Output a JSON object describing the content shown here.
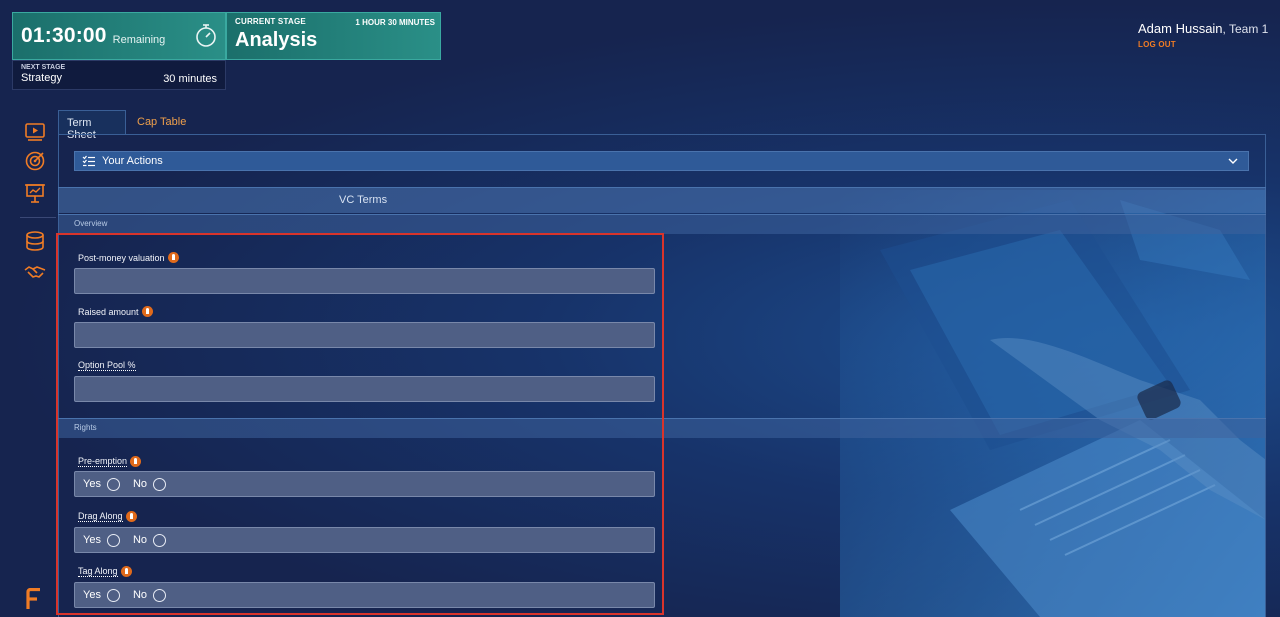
{
  "timer": {
    "time": "01:30:00",
    "remaining_label": "Remaining"
  },
  "current_stage": {
    "label": "CURRENT STAGE",
    "duration": "1 HOUR 30 MINUTES",
    "name": "Analysis"
  },
  "next_stage": {
    "label": "NEXT STAGE",
    "name": "Strategy",
    "duration": "30 minutes"
  },
  "user": {
    "name": "Adam Hussain",
    "team": ", Team 1",
    "logout": "LOG OUT"
  },
  "sidebar": {
    "icons": [
      "video-icon",
      "target-icon",
      "presentation-icon",
      "database-icon",
      "handshake-icon"
    ]
  },
  "tabs": [
    {
      "label": "Term Sheet",
      "active": true
    },
    {
      "label": "Cap Table",
      "active": false
    }
  ],
  "actions": {
    "label": "Your Actions"
  },
  "vc_terms": {
    "label": "VC Terms"
  },
  "sections": {
    "overview": {
      "label": "Overview",
      "fields": [
        {
          "label": "Post-money valuation",
          "value": ""
        },
        {
          "label": "Raised amount",
          "value": ""
        },
        {
          "label": "Option Pool %",
          "value": ""
        }
      ]
    },
    "rights": {
      "label": "Rights",
      "fields": [
        {
          "label": "Pre-emption",
          "yes": "Yes",
          "no": "No"
        },
        {
          "label": "Drag Along",
          "yes": "Yes",
          "no": "No"
        },
        {
          "label": "Tag Along",
          "yes": "Yes",
          "no": "No"
        }
      ]
    }
  },
  "colors": {
    "accent": "#f07c25",
    "timer_bg": "#2a8f87",
    "highlight": "#d9342b",
    "background": "#16244f"
  }
}
